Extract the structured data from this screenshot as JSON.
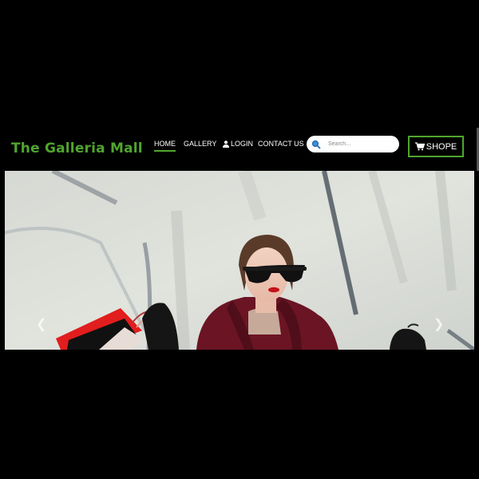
{
  "brand": {
    "title": "The Galleria Mall",
    "color": "#4fa52e"
  },
  "nav": {
    "items": [
      {
        "label": "HOME",
        "active": true
      },
      {
        "label": "GALLERY",
        "active": false
      },
      {
        "label": "LOGIN",
        "active": false,
        "icon": "user-icon"
      },
      {
        "label": "CONTACT US",
        "active": false
      }
    ]
  },
  "search": {
    "placeholder": "Search...",
    "icon": "search-icon"
  },
  "cart": {
    "label": "SHOPE",
    "icon": "shopping-cart-icon"
  },
  "carousel": {
    "prev_icon": "chevron-left-icon",
    "next_icon": "chevron-right-icon"
  }
}
